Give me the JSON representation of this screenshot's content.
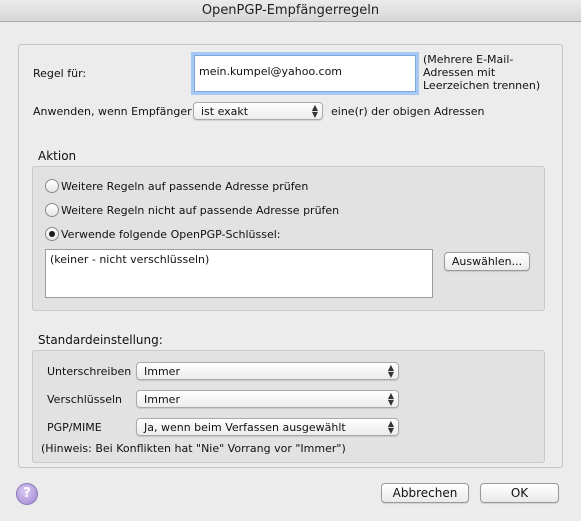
{
  "window": {
    "title": "OpenPGP-Empfängerregeln"
  },
  "rule": {
    "label": "Regel für:",
    "email_value": "mein.kumpel@yahoo.com",
    "hint_line1": "(Mehrere E-Mail-",
    "hint_line2": "Adressen mit",
    "hint_line3": "Leerzeichen trennen)"
  },
  "apply": {
    "label": "Anwenden, wenn Empfänger",
    "match_value": "ist exakt",
    "suffix": "eine(r) der obigen Adressen"
  },
  "action": {
    "title": "Aktion",
    "options": [
      {
        "label": "Weitere Regeln auf passende Adresse prüfen",
        "selected": false
      },
      {
        "label": "Weitere Regeln nicht auf passende Adresse prüfen",
        "selected": false
      },
      {
        "label": "Verwende folgende OpenPGP-Schlüssel:",
        "selected": true
      }
    ],
    "key_list_value": "(keiner - nicht verschlüsseln)",
    "select_button": "Auswählen..."
  },
  "defaults": {
    "title": "Standardeinstellung:",
    "sign_label": "Unterschreiben",
    "sign_value": "Immer",
    "encrypt_label": "Verschlüsseln",
    "encrypt_value": "Immer",
    "pgpmime_label": "PGP/MIME",
    "pgpmime_value": "Ja, wenn beim Verfassen ausgewählt",
    "note": "(Hinweis: Bei Konflikten hat \"Nie\" Vorrang vor \"Immer\")"
  },
  "footer": {
    "help_icon": "?",
    "cancel": "Abbrechen",
    "ok": "OK"
  }
}
